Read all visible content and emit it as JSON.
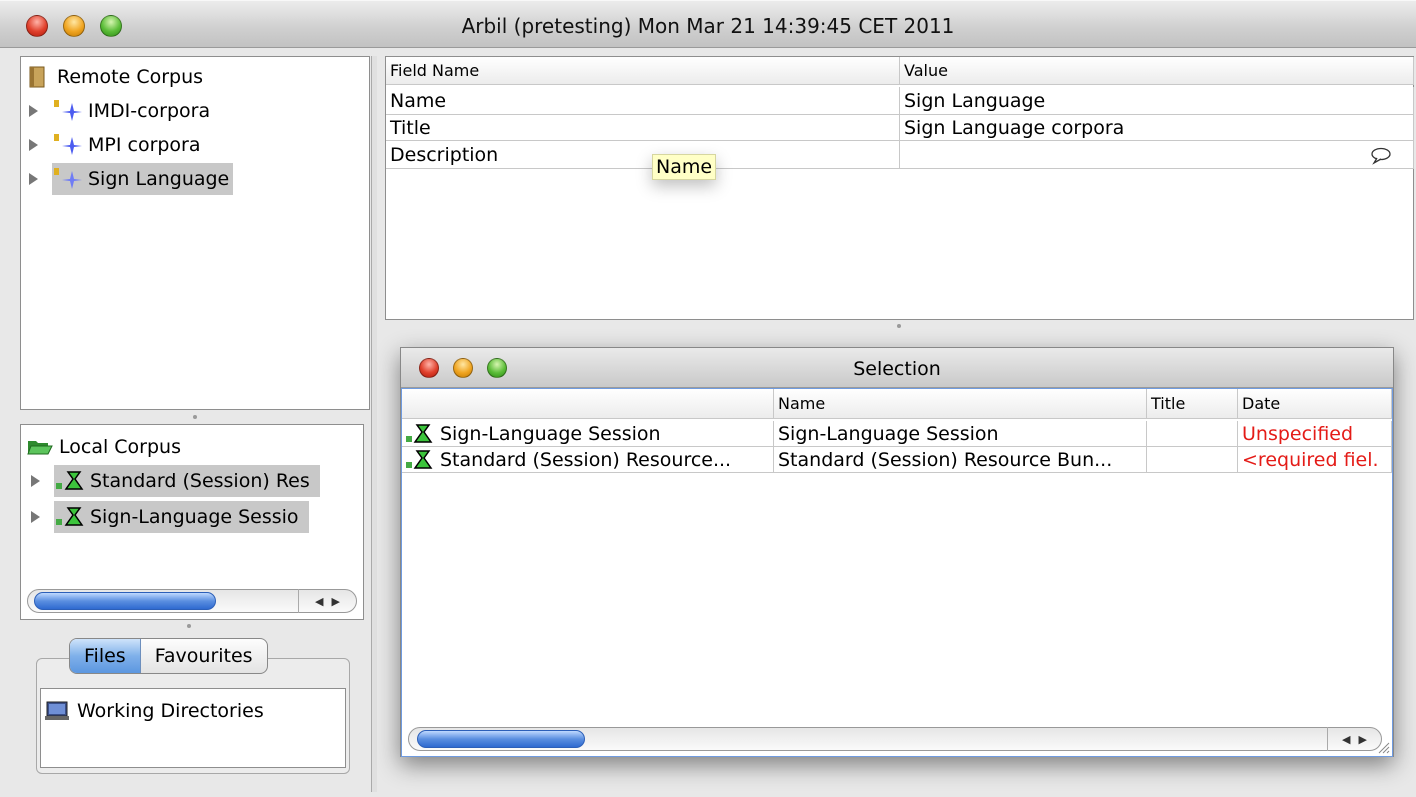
{
  "window": {
    "title": "Arbil (pretesting) Mon Mar 21 14:39:45 CET 2011"
  },
  "remote_tree": {
    "root_label": "Remote Corpus",
    "items": [
      {
        "label": "IMDI-corpora",
        "selected": false
      },
      {
        "label": "MPI corpora",
        "selected": false
      },
      {
        "label": "Sign Language",
        "selected": true
      }
    ]
  },
  "local_tree": {
    "root_label": "Local Corpus",
    "items": [
      {
        "label": "Standard (Session) Res",
        "selected": true
      },
      {
        "label": "Sign-Language Sessio",
        "selected": true
      }
    ]
  },
  "bottom_tabs": {
    "tabs": [
      {
        "label": "Files",
        "active": true
      },
      {
        "label": "Favourites",
        "active": false
      }
    ],
    "working_dirs_label": "Working Directories"
  },
  "field_table": {
    "headers": [
      "Field Name",
      "Value"
    ],
    "rows": [
      {
        "field": "Name",
        "value": "Sign Language"
      },
      {
        "field": "Title",
        "value": "Sign Language corpora"
      },
      {
        "field": "Description",
        "value": ""
      }
    ],
    "tooltip": "Name"
  },
  "selection_window": {
    "title": "Selection",
    "headers": [
      "",
      "Name",
      "Title",
      "Date"
    ],
    "rows": [
      {
        "node": "Sign-Language Session",
        "name": "Sign-Language Session",
        "title": "",
        "date": "Unspecified"
      },
      {
        "node": "Standard (Session) Resource...",
        "name": "Standard (Session) Resource Bun...",
        "title": "",
        "date": "<required fiel."
      }
    ]
  },
  "colors": {
    "selection_gray": "#c8c8c8",
    "warning_red": "#e41b17",
    "tooltip_yellow": "#ffffc6",
    "scroll_blue": "#3d74d6"
  }
}
